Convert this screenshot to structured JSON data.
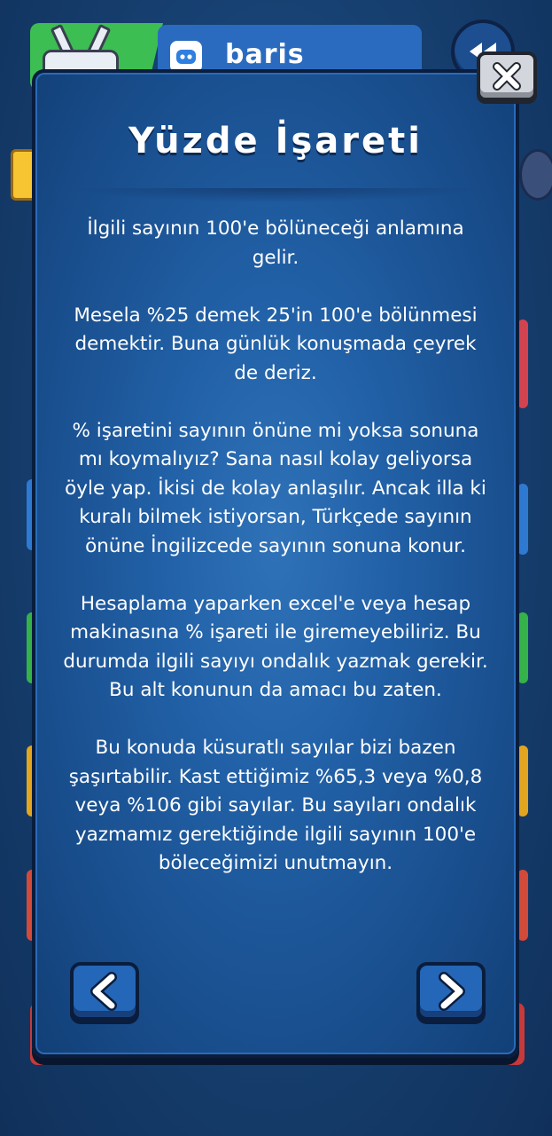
{
  "header": {
    "username": "baris"
  },
  "modal": {
    "title": "Yüzde İşareti",
    "paragraphs": [
      "İlgili sayının 100'e bölüneceği anlamına gelir.",
      "Mesela %25 demek 25'in 100'e bölünmesi demektir. Buna günlük konuşmada çeyrek de deriz.",
      "% işaretini sayının önüne mi yoksa sonuna mı koymalıyız? Sana nasıl kolay geliyorsa öyle yap. İkisi de kolay anlaşılır. Ancak illa ki kuralı bilmek istiyorsan, Türkçede sayının önüne İngilizcede sayının sonuna konur.",
      "Hesaplama yaparken excel'e veya hesap makinasına % işareti ile giremeyebiliriz. Bu durumda ilgili sayıyı ondalık yazmak gerekir. Bu alt konunun da amacı bu zaten.",
      "Bu konuda küsuratlı sayılar bizi bazen şaşırtabilir. Kast ettiğimiz %65,3 veya %0,8 veya %106 gibi sayılar. Bu sayıları ondalık yazmamız gerektiğinde ilgili sayının 100'e böleceğimizi unutmayın."
    ]
  },
  "icons": {
    "close": "close-icon",
    "prev": "chevron-left-icon",
    "next": "chevron-right-icon",
    "rewind": "rewind-icon",
    "profile": "robot-avatar-icon"
  },
  "colors": {
    "modal_bg": "#2160a6",
    "modal_border": "#0a1d3d",
    "header_bg": "#2a6bc0",
    "avatar_bg": "#3cbe52",
    "close_bg": "#d3d6dc",
    "text": "#ffffff"
  }
}
